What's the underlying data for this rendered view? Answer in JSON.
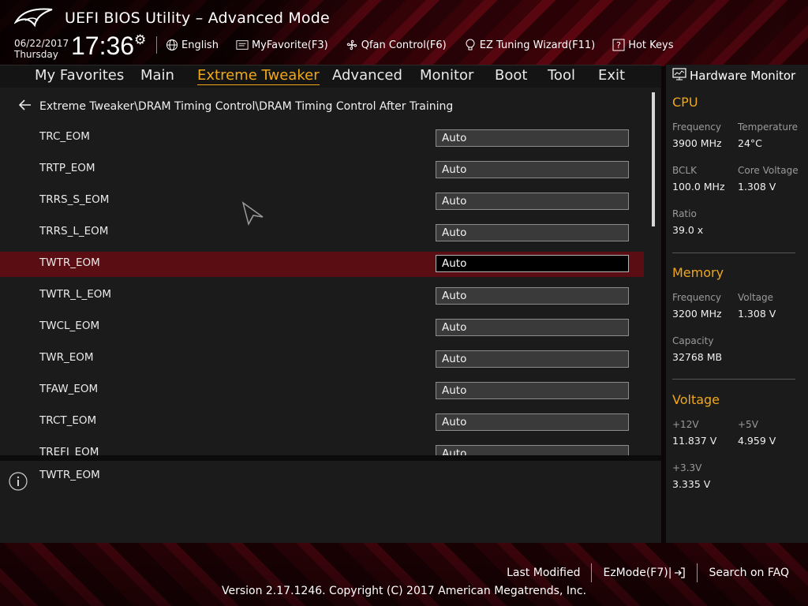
{
  "header": {
    "title": "UEFI BIOS Utility – Advanced Mode",
    "date": "06/22/2017",
    "day": "Thursday",
    "time": "17:36",
    "links": [
      {
        "label": "English",
        "icon": "globe-icon"
      },
      {
        "label": "MyFavorite(F3)",
        "icon": "favorite-icon"
      },
      {
        "label": "Qfan Control(F6)",
        "icon": "fan-icon"
      },
      {
        "label": "EZ Tuning Wizard(F11)",
        "icon": "bulb-icon"
      },
      {
        "label": "Hot Keys",
        "icon": "question-icon"
      }
    ]
  },
  "nav": {
    "tabs": [
      "My Favorites",
      "Main",
      "Extreme Tweaker",
      "Advanced",
      "Monitor",
      "Boot",
      "Tool",
      "Exit"
    ],
    "active": "Extreme Tweaker"
  },
  "breadcrumb": "Extreme Tweaker\\DRAM Timing Control\\DRAM Timing Control After Training",
  "settings": [
    {
      "label": "TRC_EOM",
      "value": "Auto"
    },
    {
      "label": "TRTP_EOM",
      "value": "Auto"
    },
    {
      "label": "TRRS_S_EOM",
      "value": "Auto"
    },
    {
      "label": "TRRS_L_EOM",
      "value": "Auto"
    },
    {
      "label": "TWTR_EOM",
      "value": "Auto",
      "selected": true
    },
    {
      "label": "TWTR_L_EOM",
      "value": "Auto"
    },
    {
      "label": "TWCL_EOM",
      "value": "Auto"
    },
    {
      "label": "TWR_EOM",
      "value": "Auto"
    },
    {
      "label": "TFAW_EOM",
      "value": "Auto"
    },
    {
      "label": "TRCT_EOM",
      "value": "Auto"
    },
    {
      "label": "TREFI_EOM",
      "value": "Auto"
    }
  ],
  "description": "TWTR_EOM",
  "hardware_monitor": {
    "title": "Hardware Monitor",
    "cpu": {
      "title": "CPU",
      "frequency_label": "Frequency",
      "frequency": "3900 MHz",
      "temperature_label": "Temperature",
      "temperature": "24°C",
      "bclk_label": "BCLK",
      "bclk": "100.0 MHz",
      "core_voltage_label": "Core Voltage",
      "core_voltage": "1.308 V",
      "ratio_label": "Ratio",
      "ratio": "39.0 x"
    },
    "memory": {
      "title": "Memory",
      "frequency_label": "Frequency",
      "frequency": "3200 MHz",
      "voltage_label": "Voltage",
      "voltage": "1.308 V",
      "capacity_label": "Capacity",
      "capacity": "32768 MB"
    },
    "voltage": {
      "title": "Voltage",
      "v12_label": "+12V",
      "v12": "11.837 V",
      "v5_label": "+5V",
      "v5": "4.959 V",
      "v33_label": "+3.3V",
      "v33": "3.335 V"
    }
  },
  "footer": {
    "last_modified": "Last Modified",
    "ezmode": "EzMode(F7)|",
    "search_faq": "Search on FAQ",
    "copyright": "Version 2.17.1246. Copyright (C) 2017 American Megatrends, Inc."
  },
  "colors": {
    "accent": "#f0a818",
    "selected_row": "#5a0d12",
    "panel": "#1b1b1b",
    "brand_red": "#5a0610"
  }
}
